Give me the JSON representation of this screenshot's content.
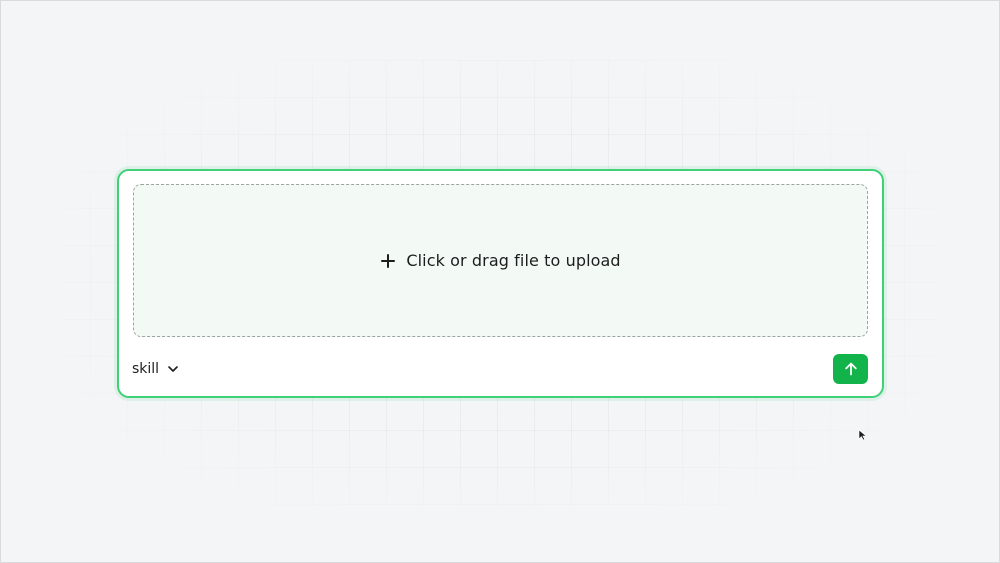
{
  "upload": {
    "label": "Click or drag file to upload",
    "icon": "plus-icon"
  },
  "selector": {
    "value": "skill",
    "icon": "chevron-down-icon"
  },
  "send": {
    "icon": "arrow-up-icon"
  },
  "colors": {
    "accent": "#3fd178",
    "button": "#12b34a",
    "dropzone_bg": "#f3faf6",
    "page_bg": "#f4f5f6"
  }
}
